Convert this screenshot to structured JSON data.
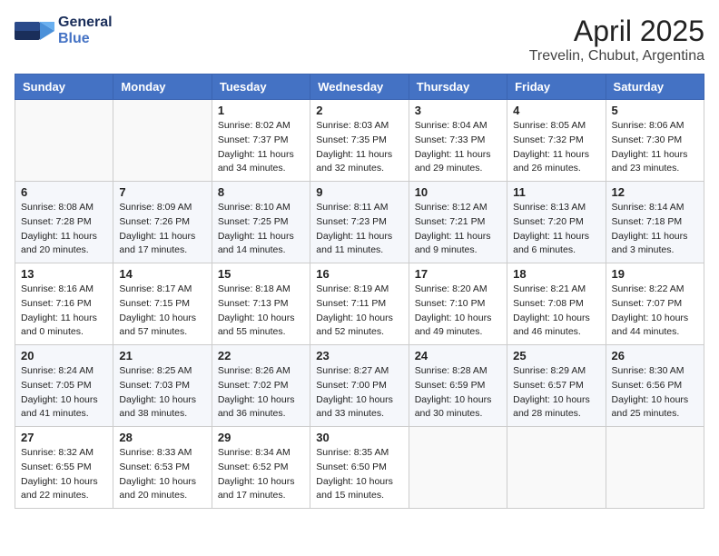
{
  "header": {
    "logo_general": "General",
    "logo_blue": "Blue",
    "title": "April 2025",
    "subtitle": "Trevelin, Chubut, Argentina"
  },
  "calendar": {
    "days_of_week": [
      "Sunday",
      "Monday",
      "Tuesday",
      "Wednesday",
      "Thursday",
      "Friday",
      "Saturday"
    ],
    "weeks": [
      [
        {
          "day": "",
          "info": ""
        },
        {
          "day": "",
          "info": ""
        },
        {
          "day": "1",
          "info": "Sunrise: 8:02 AM\nSunset: 7:37 PM\nDaylight: 11 hours and 34 minutes."
        },
        {
          "day": "2",
          "info": "Sunrise: 8:03 AM\nSunset: 7:35 PM\nDaylight: 11 hours and 32 minutes."
        },
        {
          "day": "3",
          "info": "Sunrise: 8:04 AM\nSunset: 7:33 PM\nDaylight: 11 hours and 29 minutes."
        },
        {
          "day": "4",
          "info": "Sunrise: 8:05 AM\nSunset: 7:32 PM\nDaylight: 11 hours and 26 minutes."
        },
        {
          "day": "5",
          "info": "Sunrise: 8:06 AM\nSunset: 7:30 PM\nDaylight: 11 hours and 23 minutes."
        }
      ],
      [
        {
          "day": "6",
          "info": "Sunrise: 8:08 AM\nSunset: 7:28 PM\nDaylight: 11 hours and 20 minutes."
        },
        {
          "day": "7",
          "info": "Sunrise: 8:09 AM\nSunset: 7:26 PM\nDaylight: 11 hours and 17 minutes."
        },
        {
          "day": "8",
          "info": "Sunrise: 8:10 AM\nSunset: 7:25 PM\nDaylight: 11 hours and 14 minutes."
        },
        {
          "day": "9",
          "info": "Sunrise: 8:11 AM\nSunset: 7:23 PM\nDaylight: 11 hours and 11 minutes."
        },
        {
          "day": "10",
          "info": "Sunrise: 8:12 AM\nSunset: 7:21 PM\nDaylight: 11 hours and 9 minutes."
        },
        {
          "day": "11",
          "info": "Sunrise: 8:13 AM\nSunset: 7:20 PM\nDaylight: 11 hours and 6 minutes."
        },
        {
          "day": "12",
          "info": "Sunrise: 8:14 AM\nSunset: 7:18 PM\nDaylight: 11 hours and 3 minutes."
        }
      ],
      [
        {
          "day": "13",
          "info": "Sunrise: 8:16 AM\nSunset: 7:16 PM\nDaylight: 11 hours and 0 minutes."
        },
        {
          "day": "14",
          "info": "Sunrise: 8:17 AM\nSunset: 7:15 PM\nDaylight: 10 hours and 57 minutes."
        },
        {
          "day": "15",
          "info": "Sunrise: 8:18 AM\nSunset: 7:13 PM\nDaylight: 10 hours and 55 minutes."
        },
        {
          "day": "16",
          "info": "Sunrise: 8:19 AM\nSunset: 7:11 PM\nDaylight: 10 hours and 52 minutes."
        },
        {
          "day": "17",
          "info": "Sunrise: 8:20 AM\nSunset: 7:10 PM\nDaylight: 10 hours and 49 minutes."
        },
        {
          "day": "18",
          "info": "Sunrise: 8:21 AM\nSunset: 7:08 PM\nDaylight: 10 hours and 46 minutes."
        },
        {
          "day": "19",
          "info": "Sunrise: 8:22 AM\nSunset: 7:07 PM\nDaylight: 10 hours and 44 minutes."
        }
      ],
      [
        {
          "day": "20",
          "info": "Sunrise: 8:24 AM\nSunset: 7:05 PM\nDaylight: 10 hours and 41 minutes."
        },
        {
          "day": "21",
          "info": "Sunrise: 8:25 AM\nSunset: 7:03 PM\nDaylight: 10 hours and 38 minutes."
        },
        {
          "day": "22",
          "info": "Sunrise: 8:26 AM\nSunset: 7:02 PM\nDaylight: 10 hours and 36 minutes."
        },
        {
          "day": "23",
          "info": "Sunrise: 8:27 AM\nSunset: 7:00 PM\nDaylight: 10 hours and 33 minutes."
        },
        {
          "day": "24",
          "info": "Sunrise: 8:28 AM\nSunset: 6:59 PM\nDaylight: 10 hours and 30 minutes."
        },
        {
          "day": "25",
          "info": "Sunrise: 8:29 AM\nSunset: 6:57 PM\nDaylight: 10 hours and 28 minutes."
        },
        {
          "day": "26",
          "info": "Sunrise: 8:30 AM\nSunset: 6:56 PM\nDaylight: 10 hours and 25 minutes."
        }
      ],
      [
        {
          "day": "27",
          "info": "Sunrise: 8:32 AM\nSunset: 6:55 PM\nDaylight: 10 hours and 22 minutes."
        },
        {
          "day": "28",
          "info": "Sunrise: 8:33 AM\nSunset: 6:53 PM\nDaylight: 10 hours and 20 minutes."
        },
        {
          "day": "29",
          "info": "Sunrise: 8:34 AM\nSunset: 6:52 PM\nDaylight: 10 hours and 17 minutes."
        },
        {
          "day": "30",
          "info": "Sunrise: 8:35 AM\nSunset: 6:50 PM\nDaylight: 10 hours and 15 minutes."
        },
        {
          "day": "",
          "info": ""
        },
        {
          "day": "",
          "info": ""
        },
        {
          "day": "",
          "info": ""
        }
      ]
    ]
  }
}
